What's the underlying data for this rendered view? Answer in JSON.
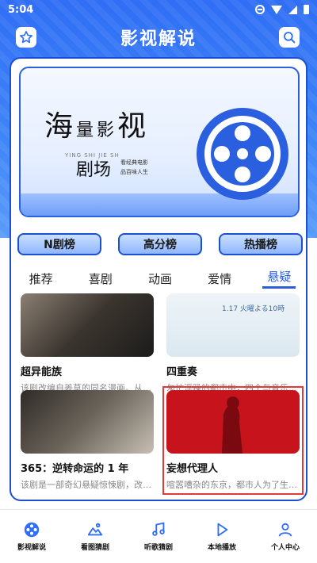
{
  "status_bar": {
    "time": "5:04"
  },
  "header": {
    "title": "影视解说"
  },
  "banner": {
    "title_big1": "海",
    "title_small1": "量",
    "title_small2": "影",
    "title_big2": "视",
    "subtitle": "剧场",
    "tag1": "看经典电影",
    "tag2": "品百味人生",
    "eng": "YING SHI JIE SH"
  },
  "categories": [
    "N剧榜",
    "高分榜",
    "热播榜"
  ],
  "tabs": [
    "推荐",
    "喜剧",
    "动画",
    "爱情",
    "悬疑"
  ],
  "active_tab": "悬疑",
  "shows": [
    {
      "name": "超异能族",
      "desc": "该剧改编自姜草的同名漫画。从…",
      "thumb_text": ""
    },
    {
      "name": "四重奏",
      "desc": "匆忙浮躁的都市中，四个与音乐…",
      "thumb_text": "1.17 火曜よる10時"
    },
    {
      "name": "365：逆转命运的 1 年",
      "desc": "该剧是一部奇幻悬疑惊悚剧，改…",
      "thumb_text": ""
    },
    {
      "name": "妄想代理人",
      "desc": "喧嚣嘈杂的东京，都市人为了生…",
      "thumb_text": ""
    }
  ],
  "bottom_nav": [
    {
      "label": "影视解说",
      "icon": "film-reel-icon"
    },
    {
      "label": "看图猜剧",
      "icon": "image-mountain-icon"
    },
    {
      "label": "听歌猜剧",
      "icon": "music-note-icon"
    },
    {
      "label": "本地播放",
      "icon": "play-icon"
    },
    {
      "label": "个人中心",
      "icon": "person-icon"
    }
  ],
  "colors": {
    "primary": "#2f6ef5",
    "active_tab": "#2b5fd9",
    "highlight_border": "#e53935"
  }
}
